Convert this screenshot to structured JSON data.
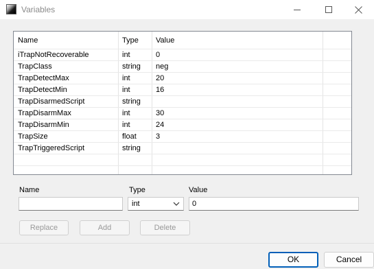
{
  "window": {
    "title": "Variables"
  },
  "grid": {
    "columns": [
      "Name",
      "Type",
      "Value"
    ],
    "rows": [
      {
        "name": "iTrapNotRecoverable",
        "type": "int",
        "value": "0"
      },
      {
        "name": "TrapClass",
        "type": "string",
        "value": "neg"
      },
      {
        "name": "TrapDetectMax",
        "type": "int",
        "value": "20"
      },
      {
        "name": "TrapDetectMin",
        "type": "int",
        "value": "16"
      },
      {
        "name": "TrapDisarmedScript",
        "type": "string",
        "value": ""
      },
      {
        "name": "TrapDisarmMax",
        "type": "int",
        "value": "30"
      },
      {
        "name": "TrapDisarmMin",
        "type": "int",
        "value": "24"
      },
      {
        "name": "TrapSize",
        "type": "float",
        "value": "3"
      },
      {
        "name": "TrapTriggeredScript",
        "type": "string",
        "value": ""
      }
    ]
  },
  "editor": {
    "name_label": "Name",
    "type_label": "Type",
    "value_label": "Value",
    "name_value": "",
    "type_selected": "int",
    "value_value": "0"
  },
  "actions": {
    "replace": "Replace",
    "add": "Add",
    "delete": "Delete"
  },
  "footer": {
    "ok": "OK",
    "cancel": "Cancel"
  },
  "icons": {
    "app": "app-icon",
    "minimize": "minimize-icon",
    "maximize": "maximize-icon",
    "close": "close-icon",
    "dropdown": "chevron-down-icon"
  },
  "colors": {
    "default_button_border": "#005fb8",
    "disabled_text": "#999999"
  }
}
